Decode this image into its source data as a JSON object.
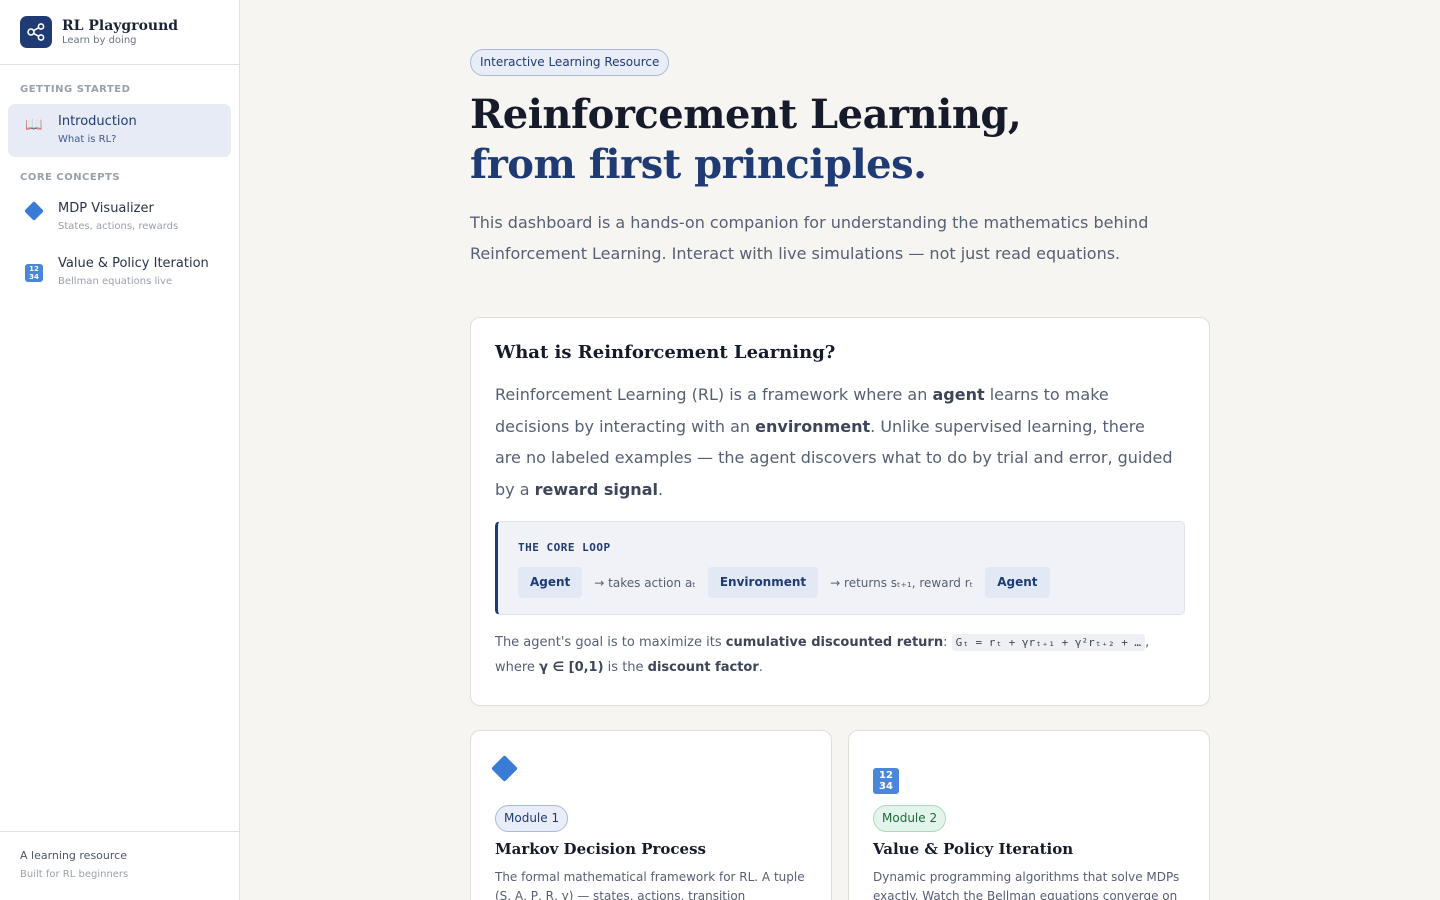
{
  "brand": {
    "title": "RL Playground",
    "subtitle": "Learn by doing"
  },
  "sidebar": {
    "sections": [
      "GETTING STARTED",
      "CORE CONCEPTS"
    ],
    "items": [
      {
        "label": "Introduction",
        "sub": "What is RL?",
        "icon": "book-icon",
        "active": true
      },
      {
        "label": "MDP Visualizer",
        "sub": "States, actions, rewards",
        "icon": "diamond-icon"
      },
      {
        "label": "Value & Policy Iteration",
        "sub": "Bellman equations live",
        "icon": "numbers-icon"
      }
    ],
    "footer": {
      "line1": "A learning resource",
      "line2": "Built for RL beginners"
    }
  },
  "hero": {
    "badge": "Interactive Learning Resource",
    "title_line1": "Reinforcement Learning,",
    "title_line2": "from first principles.",
    "description": "This dashboard is a hands-on companion for understanding the mathematics behind Reinforcement Learning. Interact with live simulations — not just read equations."
  },
  "intro": {
    "title": "What is Reinforcement Learning?",
    "p1_a": "Reinforcement Learning (RL) is a framework where an ",
    "p1_b": "agent",
    "p1_c": " learns to make decisions by interacting with an ",
    "p1_d": "environment",
    "p1_e": ". Unlike supervised learning, there are no labeled examples — the agent discovers what to do by trial and error, guided by a ",
    "p1_f": "reward signal",
    "p1_g": ".",
    "loop": {
      "heading": "THE CORE LOOP",
      "chip1": "Agent",
      "arrow1": "→ takes action aₜ",
      "chip2": "Environment",
      "arrow2": "→ returns sₜ₊₁, reward rₜ",
      "chip3": "Agent"
    },
    "foot_a": "The agent's goal is to maximize its ",
    "foot_b": "cumulative discounted return",
    "foot_c": ": ",
    "formula": "Gₜ = rₜ + γrₜ₊₁ + γ²rₜ₊₂ + …",
    "foot_d": ", where ",
    "gamma": "γ ∈ [0,1)",
    "foot_e": " is the ",
    "foot_f": "discount factor",
    "foot_g": "."
  },
  "modules": [
    {
      "badge": "Module 1",
      "title": "Markov Decision Process",
      "desc": "The formal mathematical framework for RL. A tuple (S, A, P, R, γ) — states, actions, transition",
      "icon": "diamond-icon"
    },
    {
      "badge": "Module 2",
      "title": "Value & Policy Iteration",
      "desc": "Dynamic programming algorithms that solve MDPs exactly. Watch the Bellman equations converge on",
      "icon": "numbers-icon"
    }
  ],
  "colors": {
    "brand": "#1f3b73",
    "accent": "#3a7bd5",
    "background": "#f6f5f1",
    "module2_green": "#1c6b3d"
  }
}
